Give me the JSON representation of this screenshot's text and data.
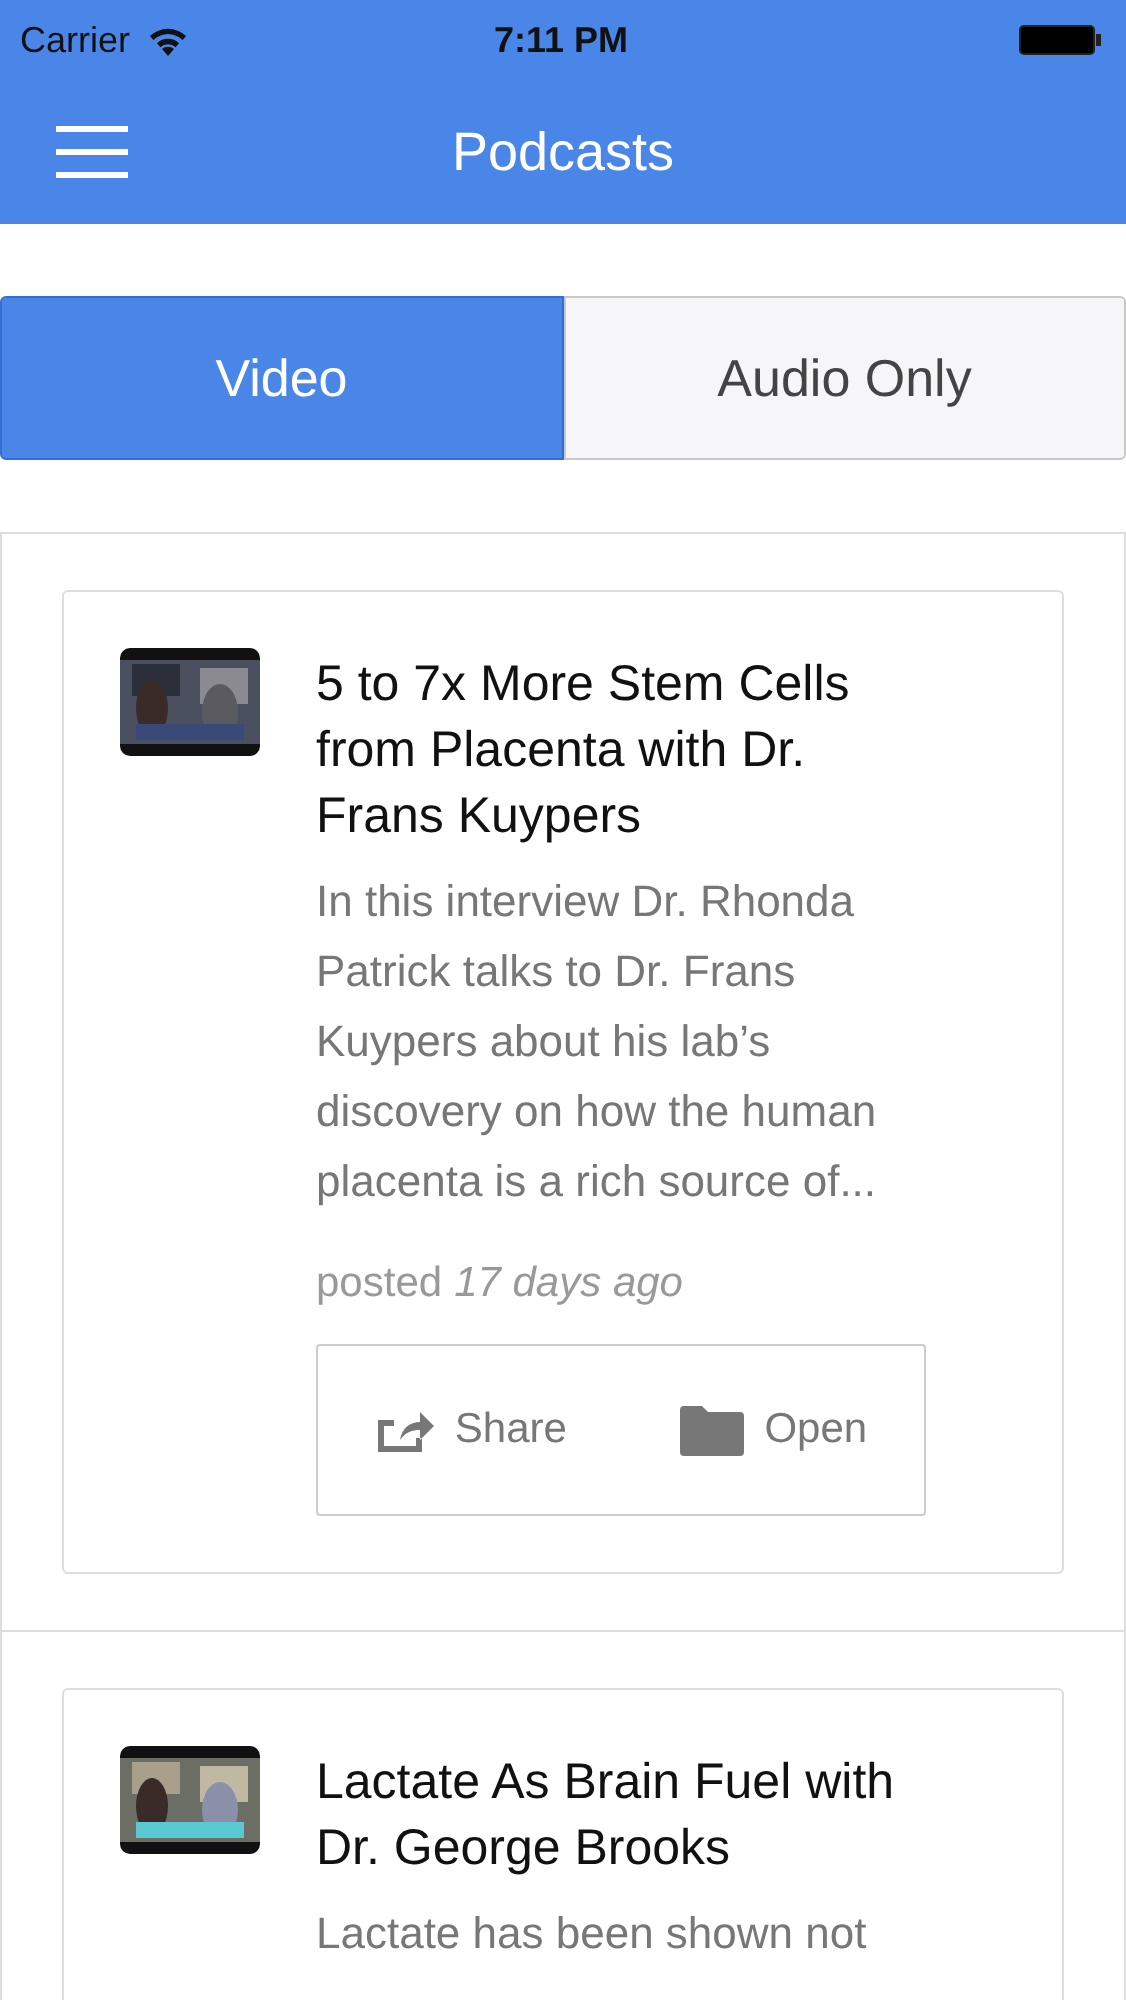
{
  "status_bar": {
    "carrier": "Carrier",
    "time": "7:11 PM"
  },
  "nav": {
    "title": "Podcasts"
  },
  "tabs": [
    {
      "label": "Video",
      "selected": true
    },
    {
      "label": "Audio Only",
      "selected": false
    }
  ],
  "posts": [
    {
      "title": "5 to 7x More Stem Cells from Placenta with Dr. Frans Kuypers",
      "description": "In this interview Dr. Rhonda Patrick talks to Dr. Frans Kuypers about his lab’s discovery on how the human placenta is a rich source of...",
      "posted_label": "posted",
      "posted_ago": "17 days ago",
      "actions": [
        {
          "kind": "share",
          "label": "Share"
        },
        {
          "kind": "open",
          "label": "Open"
        }
      ]
    },
    {
      "title": "Lactate As Brain Fuel with Dr. George Brooks",
      "description": "Lactate has been shown not"
    }
  ]
}
